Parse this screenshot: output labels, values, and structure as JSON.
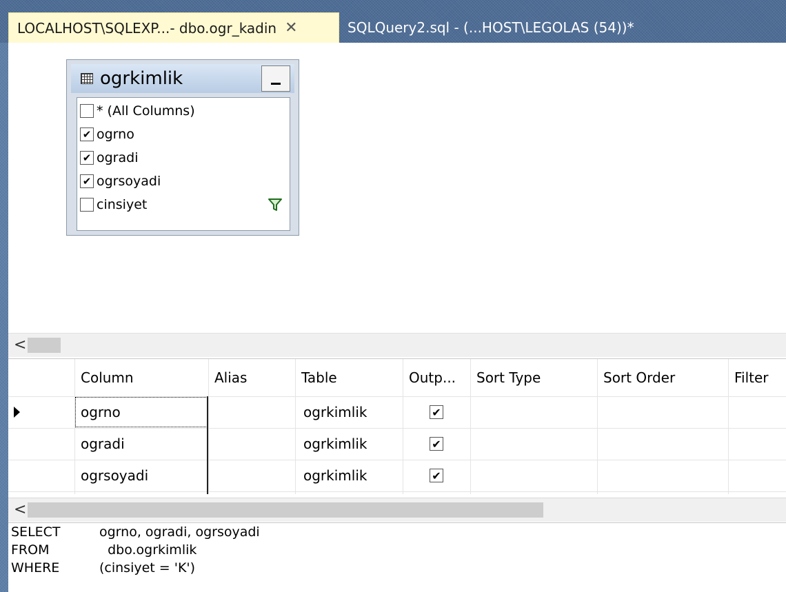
{
  "tabs": [
    {
      "label": "LOCALHOST\\SQLEXP...- dbo.ogr_kadin",
      "active": true,
      "close": "✕"
    },
    {
      "label": "SQLQuery2.sql - (...HOST\\LEGOLAS (54))*",
      "active": false
    }
  ],
  "diagram": {
    "table_name": "ogrkimlik",
    "minimize_label": "_",
    "columns": [
      {
        "name": "* (All Columns)",
        "checked": false
      },
      {
        "name": "ogrno",
        "checked": true,
        "mark": "✔"
      },
      {
        "name": "ogradi",
        "checked": true,
        "mark": "✔"
      },
      {
        "name": "ogrsoyadi",
        "checked": true,
        "mark": "✔"
      },
      {
        "name": "cinsiyet",
        "checked": false,
        "filtered": true
      }
    ]
  },
  "scroll": {
    "left_arrow": "<"
  },
  "grid": {
    "headers": [
      "Column",
      "Alias",
      "Table",
      "Outp...",
      "Sort Type",
      "Sort Order",
      "Filter"
    ],
    "rows": [
      {
        "column": "ogrno",
        "alias": "",
        "table": "ogrkimlik",
        "output": "✔",
        "selected": true
      },
      {
        "column": "ogradi",
        "alias": "",
        "table": "ogrkimlik",
        "output": "✔"
      },
      {
        "column": "ogrsoyadi",
        "alias": "",
        "table": "ogrkimlik",
        "output": "✔"
      }
    ]
  },
  "sql": {
    "lines": [
      {
        "keyword": "SELECT",
        "text": "ogrno, ogradi, ogrsoyadi"
      },
      {
        "keyword": "FROM",
        "text": "  dbo.ogrkimlik"
      },
      {
        "keyword": "WHERE",
        "text": "(cinsiyet = 'K')"
      }
    ]
  },
  "colors": {
    "active_tab": "#fffad2",
    "tab_strip": "#4e6d96",
    "table_title": "#b8cce4"
  }
}
